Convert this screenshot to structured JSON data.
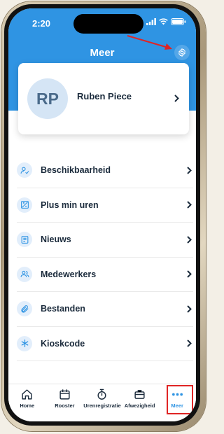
{
  "status_bar": {
    "time": "2:20"
  },
  "header": {
    "title": "Meer"
  },
  "profile": {
    "initials": "RP",
    "name": "Ruben Piece"
  },
  "menu": {
    "items": [
      {
        "label": "Beschikbaarheid",
        "icon": "person-check-icon"
      },
      {
        "label": "Plus min uren",
        "icon": "plus-minus-icon"
      },
      {
        "label": "Nieuws",
        "icon": "newspaper-icon"
      },
      {
        "label": "Medewerkers",
        "icon": "people-icon"
      },
      {
        "label": "Bestanden",
        "icon": "paperclip-icon"
      },
      {
        "label": "Kioskcode",
        "icon": "asterisk-icon"
      }
    ]
  },
  "tabbar": {
    "tabs": [
      {
        "label": "Home",
        "icon": "home-icon"
      },
      {
        "label": "Rooster",
        "icon": "calendar-icon"
      },
      {
        "label": "Urenregistratie",
        "icon": "stopwatch-icon"
      },
      {
        "label": "Afwezigheid",
        "icon": "briefcase-icon"
      },
      {
        "label": "Meer",
        "icon": "more-dots-icon",
        "active": true
      }
    ]
  },
  "colors": {
    "accent": "#2f94e3",
    "text": "#1b2b3c",
    "highlight": "#e02424"
  }
}
